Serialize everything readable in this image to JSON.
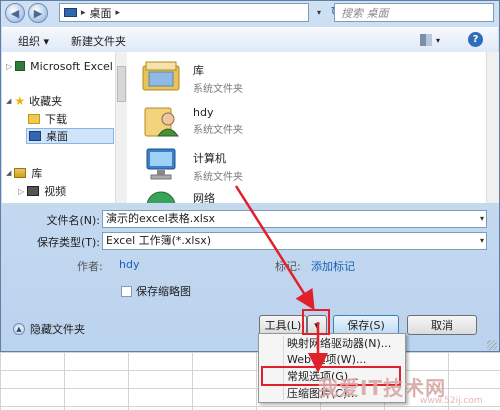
{
  "address": {
    "location": "桌面",
    "separator": "▸"
  },
  "search": {
    "placeholder": "搜索 桌面"
  },
  "toolbar": {
    "organize": "组织 ▾",
    "new_folder": "新建文件夹",
    "help": "?"
  },
  "nav": {
    "items": [
      {
        "label": "Microsoft Excel",
        "expander": "▷"
      },
      {
        "label": "收藏夹",
        "expander": "◢"
      },
      {
        "label": "下载"
      },
      {
        "label": "桌面",
        "selected": true
      },
      {
        "label": "库",
        "expander": "◢"
      },
      {
        "label": "视频",
        "expander": "▷"
      }
    ]
  },
  "files": [
    {
      "name": "库",
      "type": "系统文件夹"
    },
    {
      "name": "hdy",
      "type": "系统文件夹"
    },
    {
      "name": "计算机",
      "type": "系统文件夹"
    },
    {
      "name": "网络",
      "type": ""
    }
  ],
  "form": {
    "filename_label": "文件名(N):",
    "filename_value": "演示的excel表格.xlsx",
    "filetype_label": "保存类型(T):",
    "filetype_value": "Excel 工作簿(*.xlsx)",
    "author_label": "作者:",
    "author_value": "hdy",
    "tags_label": "标记:",
    "tags_value": "添加标记",
    "thumbnail_label": "保存缩略图"
  },
  "footer": {
    "hide_folders": "隐藏文件夹",
    "tools": "工具(L)",
    "tools_dropdown": "▾",
    "save": "保存(S)",
    "cancel": "取消"
  },
  "tools_menu": {
    "items": [
      "映射网络驱动器(N)...",
      "Web 选项(W)...",
      "常规选项(G)...",
      "压缩图片(C)..."
    ]
  },
  "watermark": {
    "text": "我爱IT技术网",
    "sub": "www.52ij.com"
  },
  "colors": {
    "highlight": "#e0202a",
    "link": "#1b5fb5",
    "selection": "#cfe4fa"
  }
}
